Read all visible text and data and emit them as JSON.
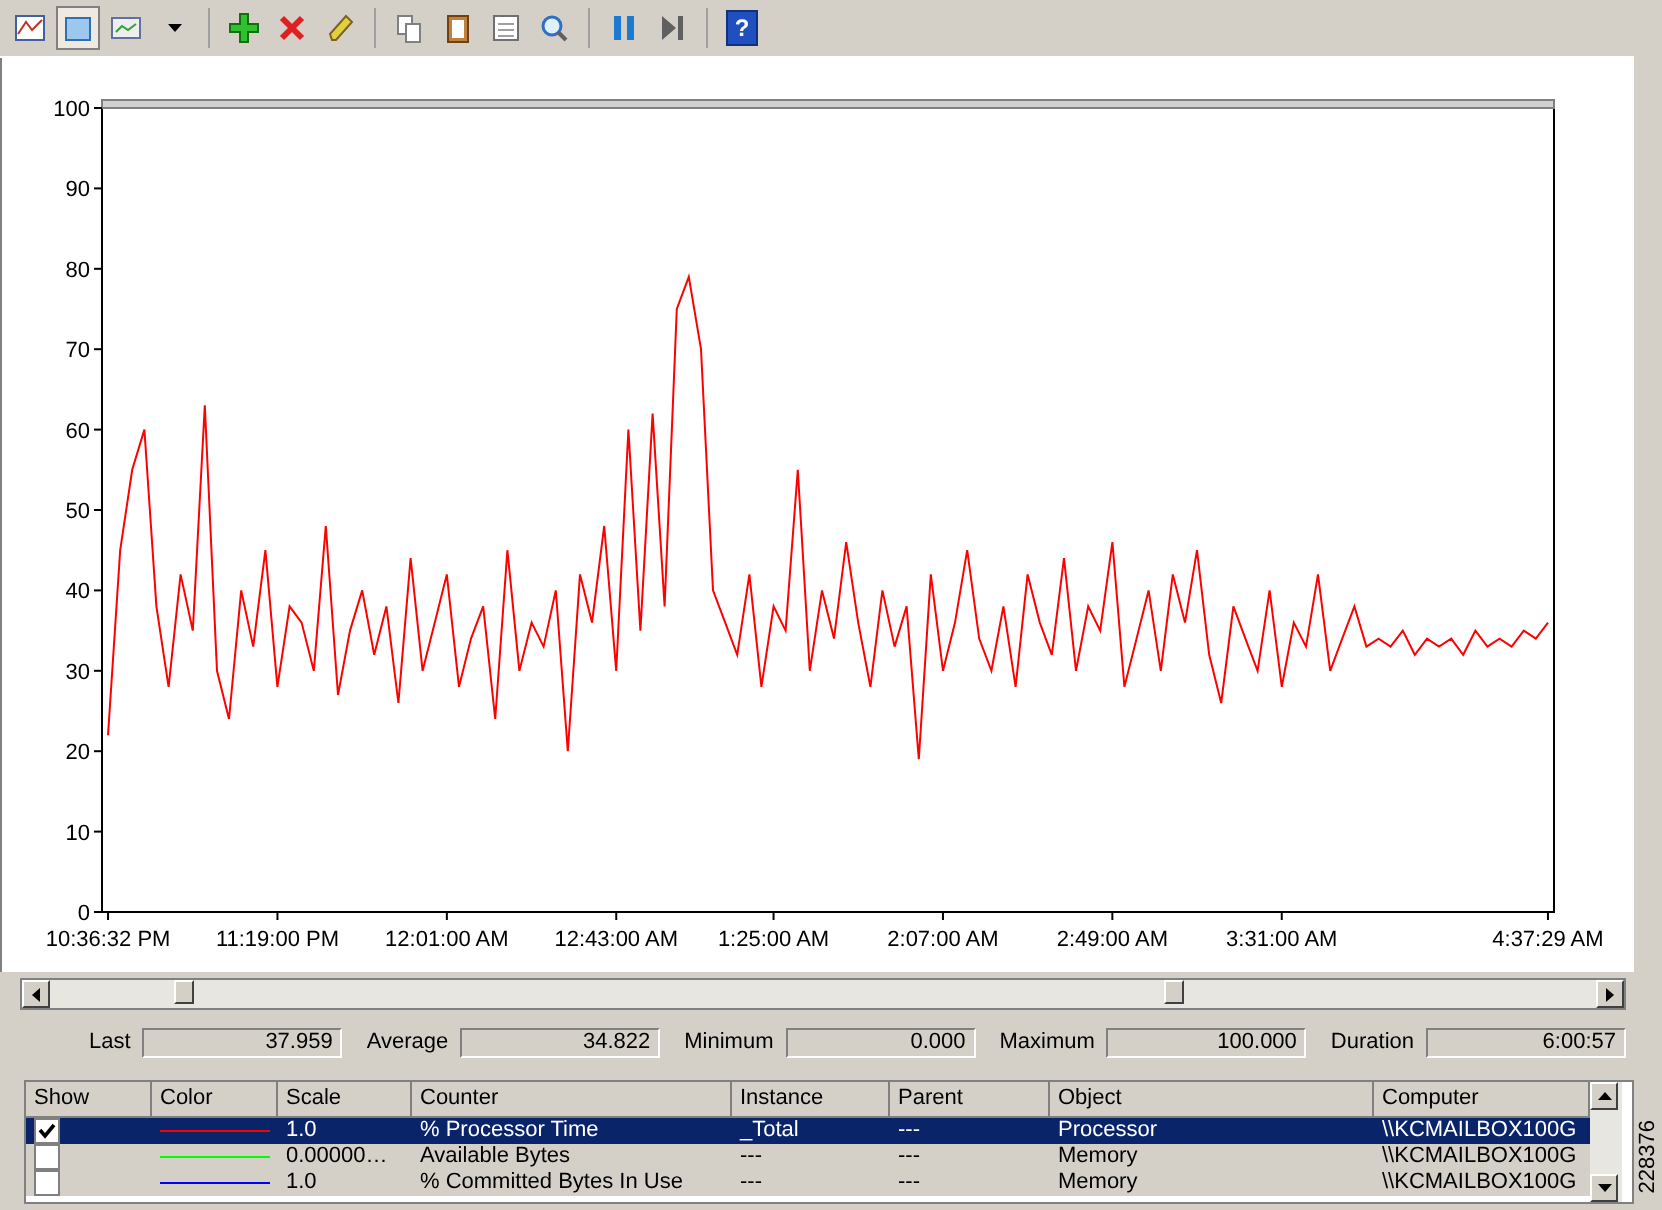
{
  "toolbar": {
    "view_buttons": [
      {
        "selected": false
      },
      {
        "selected": true
      },
      {
        "selected": false
      }
    ],
    "help_glyph": "?"
  },
  "chart": {
    "chart_data": {
      "type": "line",
      "ylim": [
        0,
        100
      ],
      "yticks": [
        0,
        10,
        20,
        30,
        40,
        50,
        60,
        70,
        80,
        90,
        100
      ],
      "categories": [
        "10:36:32 PM",
        null,
        null,
        null,
        null,
        null,
        null,
        null,
        null,
        null,
        null,
        null,
        null,
        null,
        "11:19:00 PM",
        null,
        null,
        null,
        null,
        null,
        null,
        null,
        null,
        null,
        null,
        null,
        null,
        null,
        "12:01:00 AM",
        null,
        null,
        null,
        null,
        null,
        null,
        null,
        null,
        null,
        null,
        null,
        null,
        null,
        "12:43:00 AM",
        null,
        null,
        null,
        null,
        null,
        null,
        null,
        null,
        null,
        null,
        null,
        null,
        "1:25:00 AM",
        null,
        null,
        null,
        null,
        null,
        null,
        null,
        null,
        null,
        null,
        null,
        null,
        null,
        "2:07:00 AM",
        null,
        null,
        null,
        null,
        null,
        null,
        null,
        null,
        null,
        null,
        null,
        null,
        null,
        "2:49:00 AM",
        null,
        null,
        null,
        null,
        null,
        null,
        null,
        null,
        null,
        null,
        null,
        null,
        null,
        "3:31:00 AM",
        null,
        null,
        null,
        null,
        null,
        null,
        null,
        null,
        null,
        null,
        null,
        null,
        null,
        null,
        null,
        null,
        null,
        null,
        null,
        null,
        null,
        "4:37:29 AM"
      ],
      "series": [
        {
          "color": "#ff0000",
          "values": [
            22,
            45,
            55,
            60,
            38,
            28,
            42,
            35,
            63,
            30,
            24,
            40,
            33,
            45,
            28,
            38,
            36,
            30,
            48,
            27,
            35,
            40,
            32,
            38,
            26,
            44,
            30,
            36,
            42,
            28,
            34,
            38,
            24,
            45,
            30,
            36,
            33,
            40,
            20,
            42,
            36,
            48,
            30,
            60,
            35,
            62,
            38,
            75,
            79,
            70,
            40,
            36,
            32,
            42,
            28,
            38,
            35,
            55,
            30,
            40,
            34,
            46,
            36,
            28,
            40,
            33,
            38,
            19,
            42,
            30,
            36,
            45,
            34,
            30,
            38,
            28,
            42,
            36,
            32,
            44,
            30,
            38,
            35,
            46,
            28,
            34,
            40,
            30,
            42,
            36,
            45,
            32,
            26,
            38,
            34,
            30,
            40,
            28,
            36,
            33,
            42,
            30,
            34,
            38,
            33,
            34,
            33,
            35,
            32,
            34,
            33,
            34,
            32,
            35,
            33,
            34,
            33,
            35,
            34,
            36
          ]
        }
      ]
    }
  },
  "stats": [
    {
      "label": "Last",
      "value": "37.959"
    },
    {
      "label": "Average",
      "value": "34.822"
    },
    {
      "label": "Minimum",
      "value": "0.000"
    },
    {
      "label": "Maximum",
      "value": "100.000"
    },
    {
      "label": "Duration",
      "value": "6:00:57"
    }
  ],
  "counters": {
    "columns": [
      "Show",
      "Color",
      "Scale",
      "Counter",
      "Instance",
      "Parent",
      "Object",
      "Computer"
    ],
    "rows": [
      {
        "show": true,
        "selected": true,
        "color": "#ff0000",
        "scale": "1.0",
        "counter": "% Processor Time",
        "instance": "_Total",
        "parent": "---",
        "object": "Processor",
        "computer": "\\\\KCMAILBOX100G"
      },
      {
        "show": false,
        "selected": false,
        "color": "#00ff00",
        "scale": "0.00000…",
        "counter": "Available Bytes",
        "instance": "---",
        "parent": "---",
        "object": "Memory",
        "computer": "\\\\KCMAILBOX100G"
      },
      {
        "show": false,
        "selected": false,
        "color": "#0000ff",
        "scale": "1.0",
        "counter": "% Committed Bytes In Use",
        "instance": "---",
        "parent": "---",
        "object": "Memory",
        "computer": "\\\\KCMAILBOX100G"
      }
    ]
  },
  "figure_id": "228376"
}
